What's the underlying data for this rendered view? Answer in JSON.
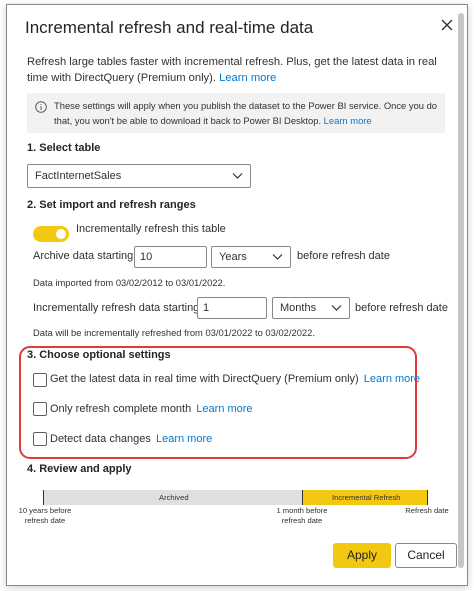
{
  "dialog": {
    "title": "Incremental refresh and real-time data",
    "intro_text": "Refresh large tables faster with incremental refresh. Plus, get the latest data in real time with DirectQuery (Premium only).",
    "intro_link": "Learn more",
    "info_text": "These settings will apply when you publish the dataset to the Power BI service. Once you do that, you won't be able to download it back to Power BI Desktop.",
    "info_link": "Learn more"
  },
  "section1": {
    "heading": "1. Select table",
    "table_value": "FactInternetSales"
  },
  "section2": {
    "heading": "2. Set import and refresh ranges",
    "toggle_label": "Incrementally refresh this table",
    "toggle_on": true,
    "archive_label": "Archive data starting",
    "archive_value": "10",
    "archive_unit": "Years",
    "archive_suffix": "before refresh date",
    "archive_note": "Data imported from 03/02/2012 to 03/01/2022.",
    "incremental_label": "Incrementally refresh data starting",
    "incremental_value": "1",
    "incremental_unit": "Months",
    "incremental_suffix": "before refresh date",
    "incremental_note": "Data will be incrementally refreshed from 03/01/2022 to 03/02/2022."
  },
  "section3": {
    "heading": "3. Choose optional settings",
    "options": [
      {
        "label": "Get the latest data in real time with DirectQuery (Premium only)",
        "link": "Learn more",
        "checked": false
      },
      {
        "label": "Only refresh complete month",
        "link": "Learn more",
        "checked": false
      },
      {
        "label": "Detect data changes",
        "link": "Learn more",
        "checked": false
      }
    ],
    "highlight_color": "#e0393e"
  },
  "section4": {
    "heading": "4. Review and apply",
    "bar_archived": "Archived",
    "bar_incremental": "Incremental Refresh",
    "axis_left_line1": "10 years before",
    "axis_left_line2": "refresh date",
    "axis_mid_line1": "1 month before",
    "axis_mid_line2": "refresh date",
    "axis_right": "Refresh date"
  },
  "buttons": {
    "apply": "Apply",
    "cancel": "Cancel"
  },
  "colors": {
    "accent_yellow": "#f2c811",
    "link_blue": "#0078d4",
    "highlight_red": "#e0393e"
  },
  "icons": {
    "close": "close-icon",
    "info": "info-icon",
    "dropdown": "chevron-down-icon"
  }
}
